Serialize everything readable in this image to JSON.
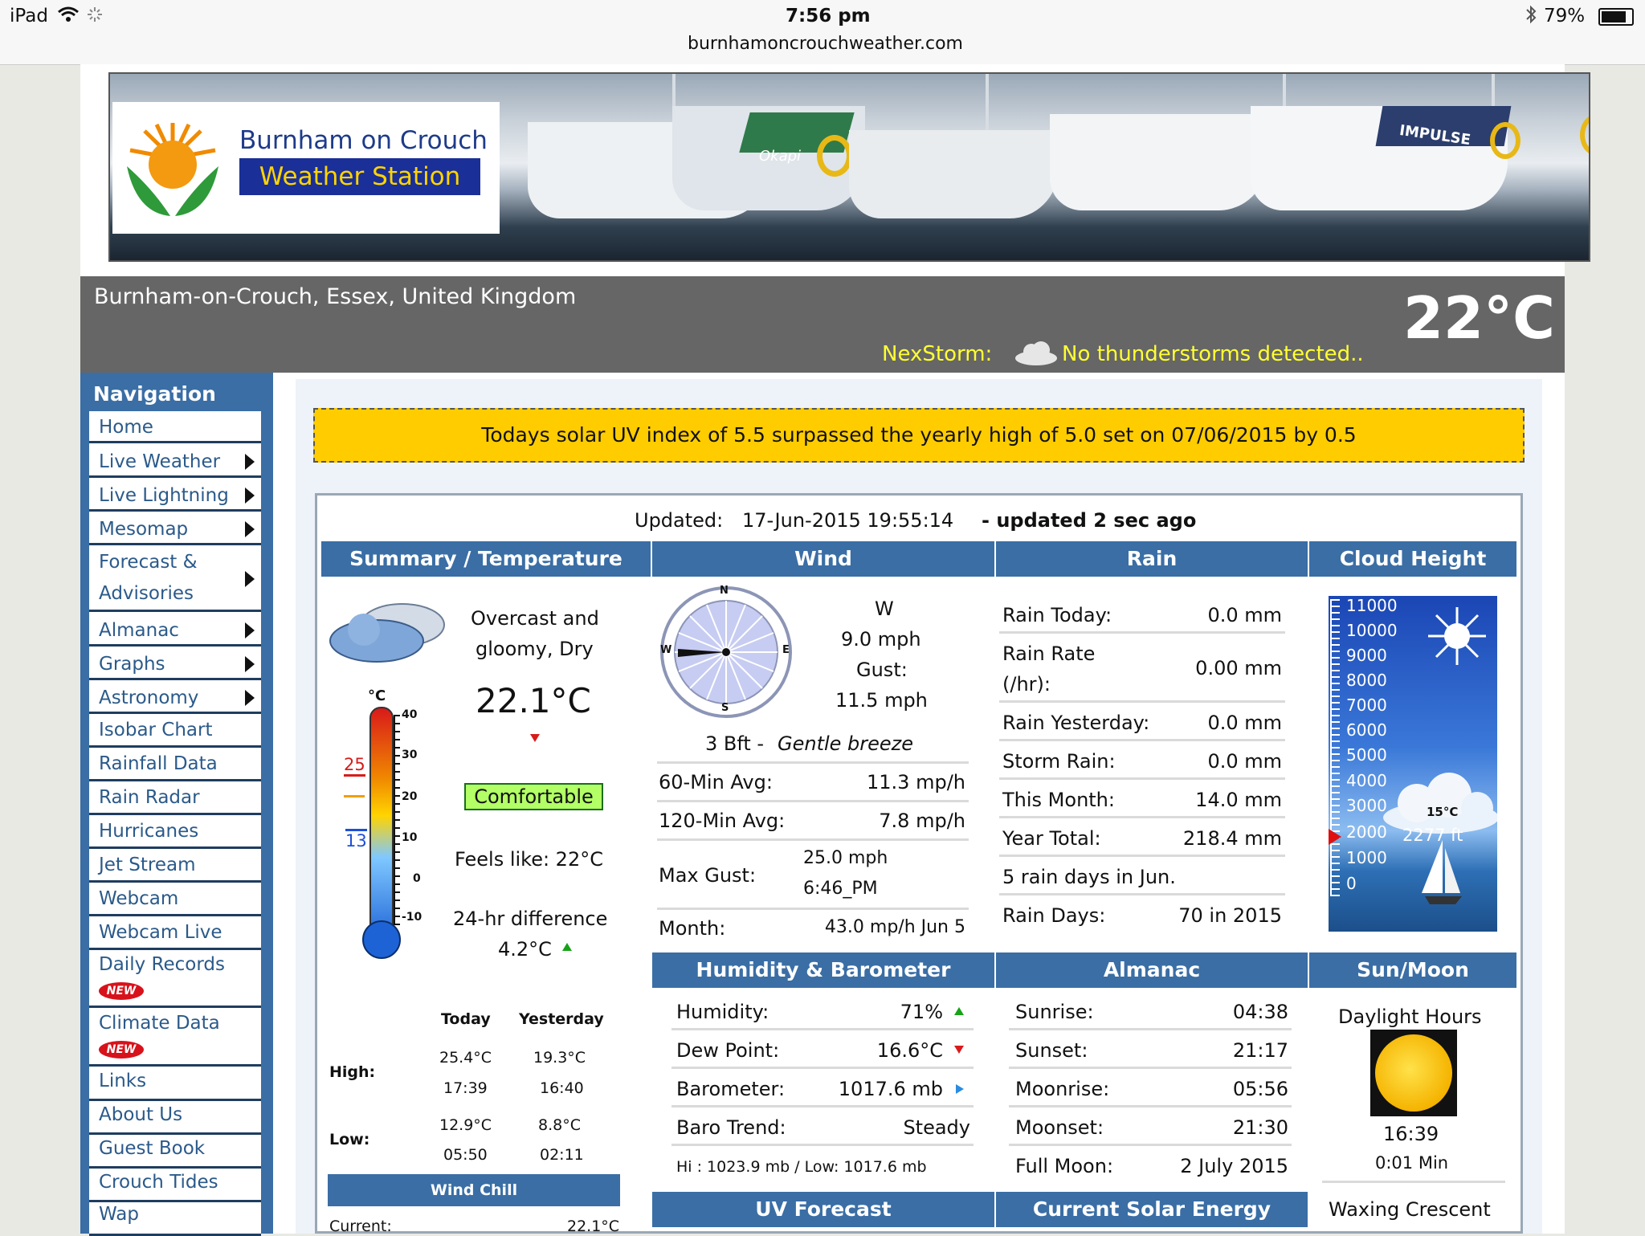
{
  "status_bar": {
    "device": "iPad",
    "time": "7:56 pm",
    "url": "burnhamoncrouchweather.com",
    "battery": "79%"
  },
  "header": {
    "logo_line1": "Burnham on Crouch",
    "logo_line2": "Weather Station",
    "boat_name_1": "Okapi",
    "boat_name_2": "IMPULSE",
    "location": "Burnham-on-Crouch, Essex, United Kingdom",
    "temperature": "22°C",
    "nexstorm_label": "NexStorm:",
    "nexstorm_status": "No thunderstorms detected.."
  },
  "navigation": {
    "title": "Navigation",
    "items": [
      {
        "label": "Home"
      },
      {
        "label": "Live Weather"
      },
      {
        "label": "Live Lightning"
      },
      {
        "label": "Mesomap"
      },
      {
        "label": "Forecast &"
      },
      {
        "label": "Advisories"
      },
      {
        "label": "Almanac"
      },
      {
        "label": "Graphs"
      },
      {
        "label": "Astronomy"
      },
      {
        "label": "Isobar Chart"
      },
      {
        "label": "Rainfall Data"
      },
      {
        "label": "Rain Radar"
      },
      {
        "label": "Hurricanes"
      },
      {
        "label": "Jet Stream"
      },
      {
        "label": "Webcam"
      },
      {
        "label": "Webcam Live"
      },
      {
        "label": "Daily Records"
      },
      {
        "label": "Climate Data"
      },
      {
        "label": "Links"
      },
      {
        "label": "About Us"
      },
      {
        "label": "Guest Book"
      },
      {
        "label": "Crouch Tides"
      },
      {
        "label": "Wap"
      }
    ],
    "new_badge": "NEW"
  },
  "alert": "Todays solar UV index of 5.5 surpassed the yearly high of 5.0 set on 07/06/2015 by 0.5",
  "updated": {
    "label": "Updated:",
    "datetime": "17-Jun-2015 19:55:14",
    "suffix": "- updated 2 sec ago"
  },
  "sections": {
    "summary": "Summary / Temperature",
    "wind": "Wind",
    "rain": "Rain",
    "cloud": "Cloud Height",
    "humidity": "Humidity & Barometer",
    "almanac": "Almanac",
    "sunmoon": "Sun/Moon",
    "wind_chill": "Wind Chill",
    "uv_forecast": "UV Forecast",
    "solar": "Current Solar Energy"
  },
  "summary": {
    "condition_1": "Overcast and",
    "condition_2": "gloomy, Dry",
    "temp": "22.1°C",
    "comfort": "Comfortable",
    "feels_like": "Feels like: 22°C",
    "diff_label": "24-hr difference",
    "diff_value": "4.2°C",
    "therm_unit": "°C",
    "therm_high": "25",
    "therm_low": "13",
    "therm_ticks": [
      "40",
      "30",
      "20",
      "10",
      "0",
      "-10"
    ],
    "col_today": "Today",
    "col_yesterday": "Yesterday",
    "high_label": "High:",
    "low_label": "Low:",
    "high_today": "25.4°C",
    "high_today_time": "17:39",
    "high_yest": "19.3°C",
    "high_yest_time": "16:40",
    "low_today": "12.9°C",
    "low_today_time": "05:50",
    "low_yest": "8.8°C",
    "low_yest_time": "02:11",
    "chill_label": "Current:",
    "chill_value": "22.1°C"
  },
  "wind": {
    "direction": "W",
    "speed": "9.0 mph",
    "gust_label": "Gust:",
    "gust": "11.5 mph",
    "beaufort": "3 Bft -",
    "beaufort_desc": "Gentle breeze",
    "avg60_label": "60-Min Avg:",
    "avg60": "11.3 mp/h",
    "avg120_label": "120-Min Avg:",
    "avg120": "7.8 mp/h",
    "maxgust_label": "Max Gust:",
    "maxgust": "25.0 mph",
    "maxgust_time": "6:46_PM",
    "month_label": "Month:",
    "month": "43.0 mp/h Jun 5",
    "compass": {
      "n": "N",
      "e": "E",
      "s": "S",
      "w": "W"
    }
  },
  "rain": {
    "today_label": "Rain Today:",
    "today": "0.0 mm",
    "rate_label_1": "Rain Rate",
    "rate_label_2": "(/hr):",
    "rate": "0.00 mm",
    "yesterday_label": "Rain Yesterday:",
    "yesterday": "0.0 mm",
    "storm_label": "Storm Rain:",
    "storm": "0.0 mm",
    "month_label": "This Month:",
    "month": "14.0 mm",
    "year_label": "Year Total:",
    "year": "218.4 mm",
    "raindays_note": "5 rain days in Jun.",
    "days_label": "Rain Days:",
    "days": "70 in 2015"
  },
  "cloud": {
    "scale": [
      "11000",
      "10000",
      "9000",
      "8000",
      "7000",
      "6000",
      "5000",
      "4000",
      "3000",
      "2000",
      "1000",
      "0"
    ],
    "temp": "15°C",
    "height": "2277 ft"
  },
  "humidity": {
    "hum_label": "Humidity:",
    "hum": "71%",
    "dew_label": "Dew Point:",
    "dew": "16.6°C",
    "baro_label": "Barometer:",
    "baro": "1017.6 mb",
    "trend_label": "Baro Trend:",
    "trend": "Steady",
    "hilo": "Hi : 1023.9 mb / Low:  1017.6 mb"
  },
  "almanac": {
    "sunrise_label": "Sunrise:",
    "sunrise": "04:38",
    "sunset_label": "Sunset:",
    "sunset": "21:17",
    "moonrise_label": "Moonrise:",
    "moonrise": "05:56",
    "moonset_label": "Moonset:",
    "moonset": "21:30",
    "fullmoon_label": "Full Moon:",
    "fullmoon": "2 July 2015"
  },
  "sunmoon": {
    "daylight_label": "Daylight Hours",
    "daylight": "16:39",
    "change": "0:01 Min",
    "phase": "Waxing Crescent"
  }
}
